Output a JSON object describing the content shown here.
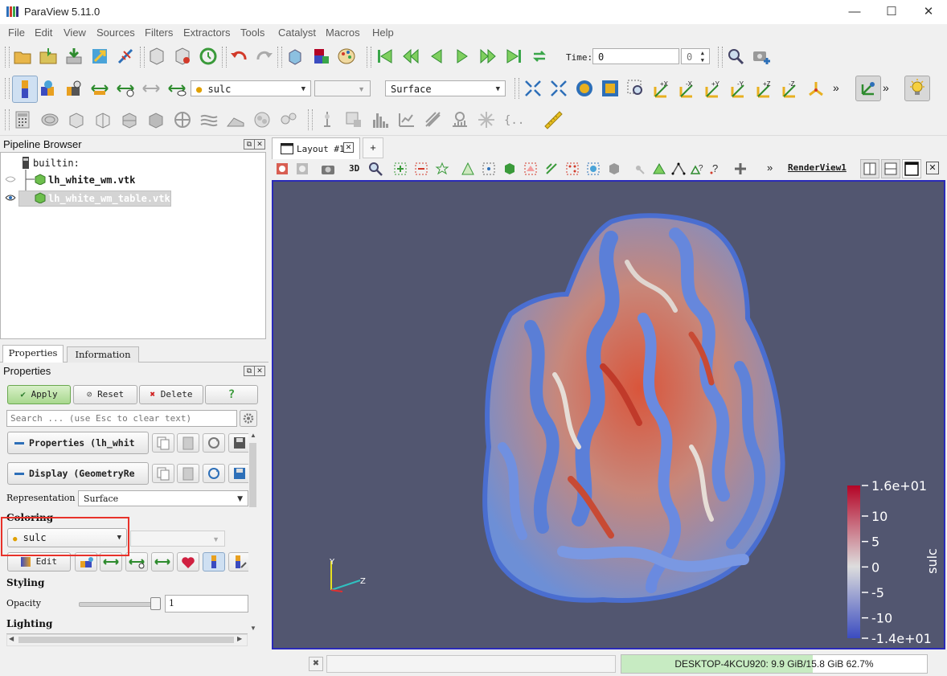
{
  "window": {
    "title": "ParaView 5.11.0",
    "minimize_glyph": "—",
    "maximize_glyph": "☐",
    "close_glyph": "✕"
  },
  "menu": [
    {
      "label": "File"
    },
    {
      "label": "Edit"
    },
    {
      "label": "View"
    },
    {
      "label": "Sources"
    },
    {
      "label": "Filters"
    },
    {
      "label": "Extractors"
    },
    {
      "label": "Tools"
    },
    {
      "label": "Catalyst"
    },
    {
      "label": "Macros"
    },
    {
      "label": "Help"
    }
  ],
  "toolbar": {
    "time_label": "Time:",
    "time_value": "0",
    "time_step": "0",
    "array_combo": "sulc",
    "component_combo": "",
    "representation_combo": "Surface",
    "more_glyph": "»"
  },
  "pipeline": {
    "title": "Pipeline Browser",
    "root": "builtin:",
    "items": [
      {
        "label": "lh_white_wm.vtk",
        "selected": false
      },
      {
        "label": "lh_white_wm_table.vtk",
        "selected": true
      }
    ]
  },
  "tabs": {
    "properties": "Properties",
    "information": "Information"
  },
  "properties": {
    "title": "Properties",
    "apply": "Apply",
    "reset": "Reset",
    "delete": "Delete",
    "help": "?",
    "search_placeholder": "Search ... (use Esc to clear text)",
    "group_properties": "Properties (lh_whit",
    "group_display": "Display (GeometryRe",
    "representation_label": "Representation",
    "representation_value": "Surface",
    "coloring_label": "Coloring",
    "coloring_value": "sulc",
    "edit_label": "Edit",
    "styling_label": "Styling",
    "opacity_label": "Opacity",
    "opacity_value": "1",
    "opacity_level": 1.0,
    "lighting_label": "Lighting"
  },
  "layout": {
    "tab_label": "Layout #1",
    "add_tab": "+",
    "view_name": "RenderView1",
    "mode_3d": "3D"
  },
  "colorbar": {
    "title": "sulc",
    "ticks": [
      "1.6e+01",
      "10",
      "5",
      "0",
      "-5",
      "-10",
      "-1.4e+01"
    ],
    "max": 16,
    "min": -14,
    "colors": {
      "high": "#b40426",
      "mid": "#dddddd",
      "low": "#3b4cc0"
    }
  },
  "axes": {
    "y": "Y",
    "z": "Z"
  },
  "render": {
    "background": "#525670"
  },
  "status": {
    "memory": "DESKTOP-4KCU920: 9.9 GiB/15.8 GiB 62.7%",
    "memory_fraction": 0.627
  }
}
